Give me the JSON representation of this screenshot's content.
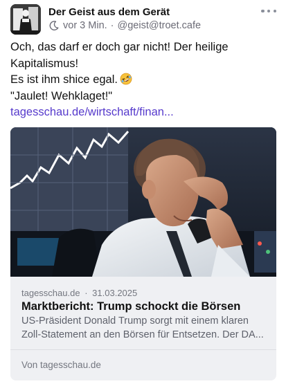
{
  "post": {
    "display_name": "Der Geist aus dem Gerät",
    "time": "vor 3 Min.",
    "separator": "·",
    "handle": "@geist@troet.cafe",
    "lines": [
      "Och, das darf er doch gar nicht! Der heilige",
      "Kapitalismus!",
      "Es ist ihm shice egal.",
      "\"Jaulet! Wehklaget!\""
    ],
    "emoji_name": "rolling-on-the-floor-laughing-emoji",
    "link_text": "tagesschau.de/wirtschaft/finan..."
  },
  "card": {
    "domain": "tagesschau.de",
    "date": "31.03.2025",
    "meta_separator": "·",
    "title": "Marktbericht: Trump schockt die Börsen",
    "description_lines": [
      "US-Präsident Donald Trump sorgt mit einem klaren",
      "Zoll-Statement an den Börsen für Entsetzen. Der DA..."
    ],
    "source_label": "Von tagesschau.de"
  },
  "icons": {
    "visibility": "moon-icon",
    "menu": "more-horizontal-icon"
  },
  "colors": {
    "link": "#563acc",
    "muted": "#6b6b76",
    "card_bg": "#eff0f3"
  }
}
